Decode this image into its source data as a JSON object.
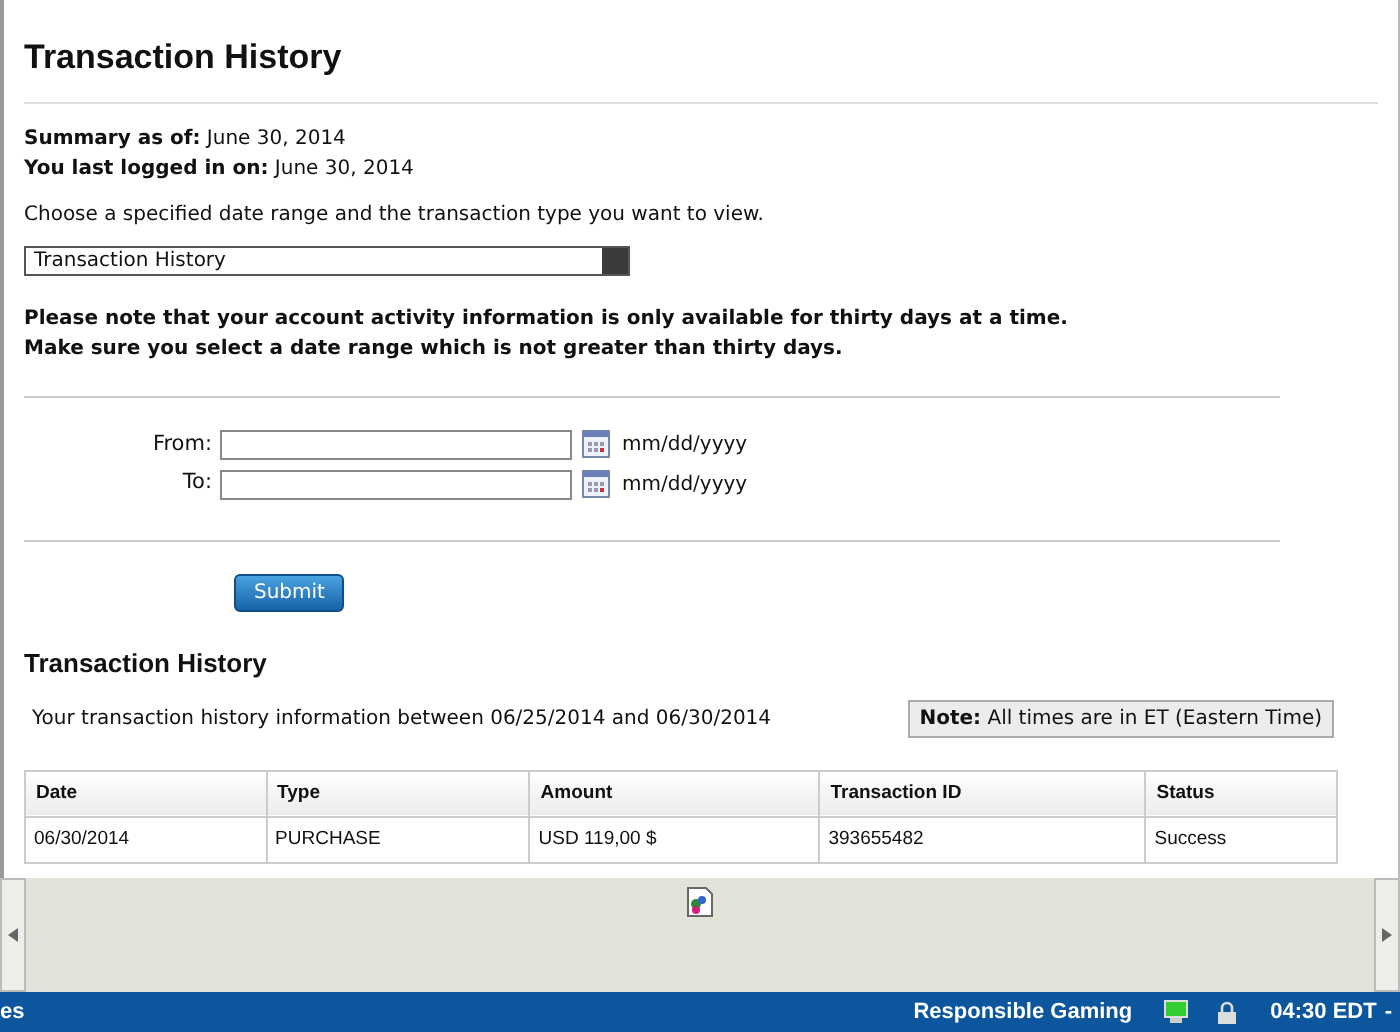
{
  "title": "Transaction History",
  "summary": [
    {
      "label": "Summary as of:",
      "value": "June 30, 2014"
    },
    {
      "label": "You last logged in on:",
      "value": "June 30, 2014"
    }
  ],
  "instruction": "Choose a specified date range and the transaction type you want to view.",
  "type_select": {
    "value": "Transaction History"
  },
  "notice": [
    "Please note that your account activity information is only available for thirty days at a time.",
    "Make sure you select a date range which is not greater than thirty days."
  ],
  "date_fields": [
    {
      "label": "From:",
      "hint": "mm/dd/yyyy"
    },
    {
      "label": "To:",
      "hint": "mm/dd/yyyy"
    }
  ],
  "submit": "Submit",
  "history": {
    "heading": "Transaction History",
    "range_text": "Your transaction history information between 06/25/2014 and 06/30/2014",
    "note": "**Note:** All times are in ET (Eastern Time)",
    "columns": [
      "Date",
      "Type",
      "Amount",
      "Transaction ID",
      "Status"
    ],
    "rows": [
      [
        "06/30/2014",
        "PURCHASE",
        "USD 119,00 $",
        "393655482",
        "Success"
      ]
    ]
  },
  "taskbar": {
    "left_text": "es",
    "link": "Responsible Gaming",
    "clock": "04:30 EDT",
    "clock_suffix": "-"
  }
}
